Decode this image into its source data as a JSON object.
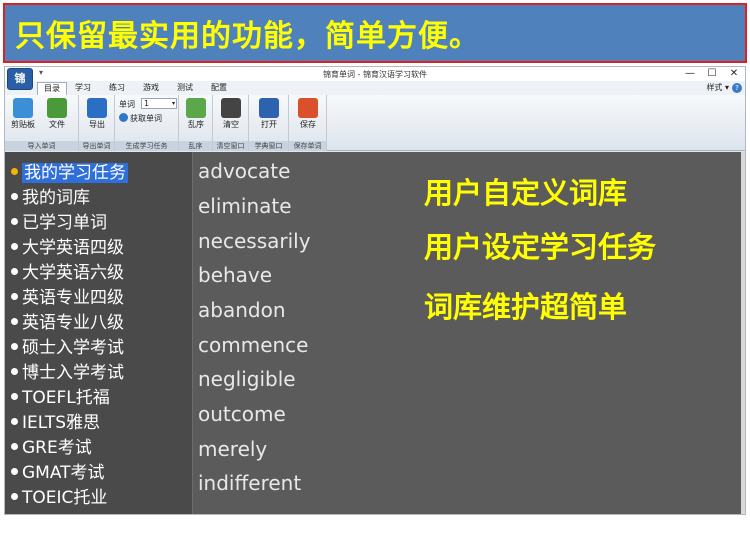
{
  "banner": {
    "text": "只保留最实用的功能，简单方便。"
  },
  "window": {
    "app_icon_label": "锦",
    "qat_pin": "▾",
    "title": "锦育单词 - 锦育汉语学习软件",
    "minimize": "—",
    "maximize": "☐",
    "close": "✕"
  },
  "tabs": [
    "目录",
    "学习",
    "练习",
    "游戏",
    "测试",
    "配置"
  ],
  "style_menu": "样式 ▾",
  "help": "?",
  "ribbon": {
    "clipboard_label": "剪贴板",
    "file_label": "文件",
    "import_group": "导入单词",
    "export_label": "导出",
    "export_group": "导出单词",
    "word_count_label": "单词",
    "word_count_value": "1",
    "fetch_label": "获取单词",
    "generate_group": "生成学习任务",
    "shuffle_label": "乱序",
    "shuffle_group": "乱序",
    "clear_label": "清空",
    "clear_group": "清空窗口",
    "open_label": "打开",
    "save_label": "保存",
    "save_group": "保存单词",
    "open_group_label": "学典窗口"
  },
  "task_list": [
    "我的学习任务",
    "我的词库",
    "已学习单词",
    "大学英语四级",
    "大学英语六级",
    "英语专业四级",
    "英语专业八级",
    "硕士入学考试",
    "博士入学考试",
    "TOEFL托福",
    "IELTS雅思",
    "GRE考试",
    "GMAT考试",
    "TOEIC托业"
  ],
  "words": [
    "advocate",
    "eliminate",
    "necessarily",
    "behave",
    "abandon",
    "commence",
    "negligible",
    "outcome",
    "merely",
    "indifferent"
  ],
  "features": [
    "用户自定义词库",
    "用户设定学习任务",
    "词库维护超简单"
  ],
  "colors": {
    "banner_bg": "#4f81bd",
    "banner_border": "#e02020",
    "highlight_text": "#ffff00",
    "selection": "#2e6fd9"
  }
}
